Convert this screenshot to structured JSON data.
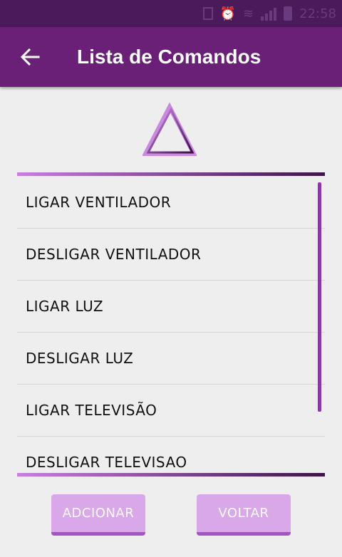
{
  "colors": {
    "status_bar": "#4a1a5a",
    "app_bar": "#6a2077",
    "accent": "#8a38a8",
    "button_bg": "#d8a8e8",
    "background": "#eeeeee"
  },
  "status_bar": {
    "time": "22:58",
    "icons": [
      "sim-icon",
      "alarm-icon",
      "wifi-icon",
      "signal-icon",
      "battery-icon"
    ]
  },
  "app_bar": {
    "title": "Lista de Comandos",
    "back_icon": "arrow-back-icon"
  },
  "logo": {
    "icon": "triangle-logo-icon"
  },
  "commands": {
    "items": [
      {
        "label": "LIGAR VENTILADOR"
      },
      {
        "label": "DESLIGAR VENTILADOR"
      },
      {
        "label": "LIGAR LUZ"
      },
      {
        "label": "DESLIGAR LUZ"
      },
      {
        "label": "LIGAR TELEVISÃO"
      },
      {
        "label": "DESLIGAR TELEVISAO"
      }
    ]
  },
  "actions": {
    "add_label": "ADCIONAR",
    "back_label": "VOLTAR"
  }
}
